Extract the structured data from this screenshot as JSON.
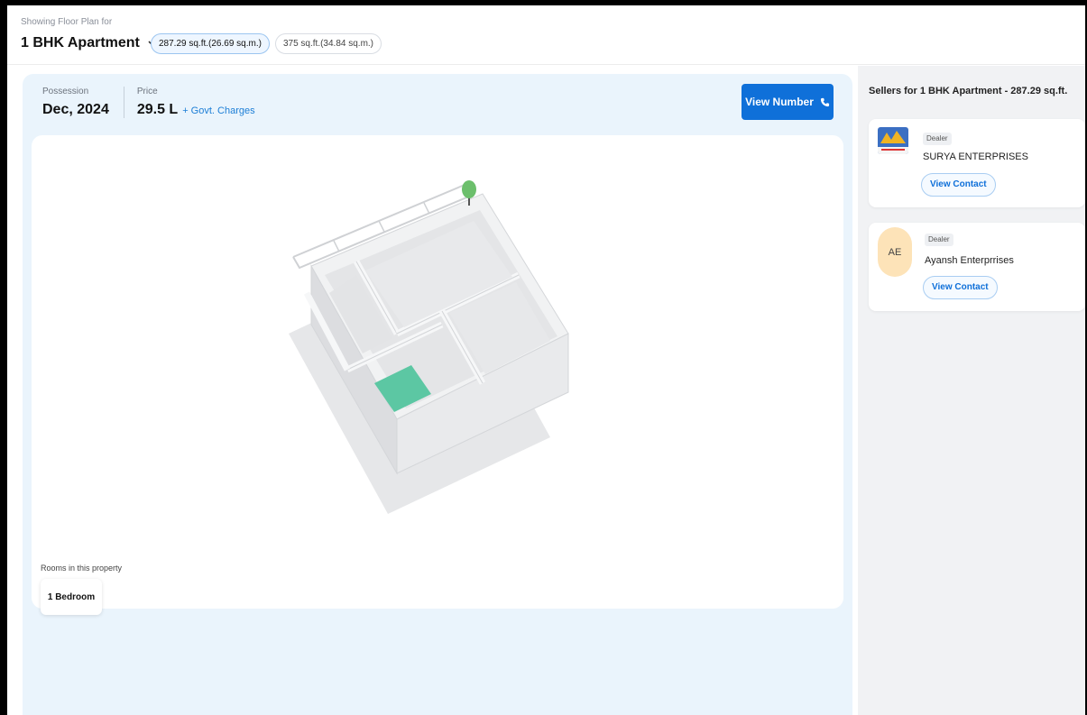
{
  "header": {
    "showing_label": "Showing Floor Plan for",
    "config_title": "1 BHK Apartment",
    "area_options": [
      "287.29 sq.ft.(26.69 sq.m.)",
      "375 sq.ft.(34.84 sq.m.)"
    ],
    "selected_area_index": 0
  },
  "property": {
    "possession_label": "Possession",
    "possession_value": "Dec, 2024",
    "price_label": "Price",
    "price_value": "29.5 L",
    "govt_charges": "+ Govt. Charges",
    "view_number_label": "View Number"
  },
  "plan": {
    "rooms_label": "Rooms in this property",
    "rooms": [
      "1 Bedroom"
    ]
  },
  "sellers": {
    "title": "Sellers for 1 BHK Apartment - 287.29 sq.ft.",
    "items": [
      {
        "type_label": "Dealer",
        "name": "SURYA ENTERPRISES",
        "contact_label": "View Contact",
        "logo": "company-logo"
      },
      {
        "type_label": "Dealer",
        "name": "Ayansh Enterprrises",
        "contact_label": "View Contact",
        "avatar_initials": "AE"
      }
    ]
  },
  "colors": {
    "accent": "#0f70d9",
    "panel_bg": "#eaf4fc",
    "sidebar_bg": "#f1f2f4",
    "avatar_bg": "#fde3b8",
    "room_highlight": "#5cc7a3",
    "tree_green": "#6cbf6c"
  },
  "icons": {
    "dropdown": "chevron-down-icon",
    "phone": "phone-icon"
  }
}
